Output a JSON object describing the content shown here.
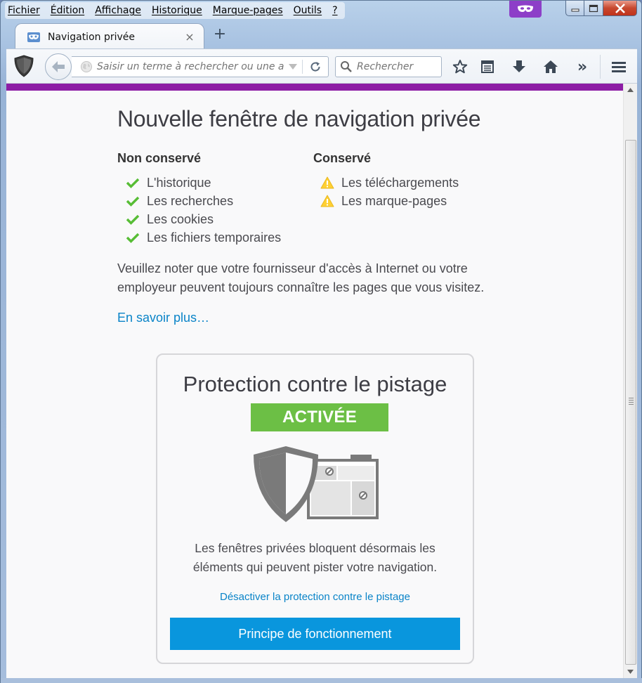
{
  "menubar": {
    "items": [
      "Fichier",
      "Édition",
      "Affichage",
      "Historique",
      "Marque-pages",
      "Outils",
      "?"
    ]
  },
  "tab": {
    "title": "Navigation privée",
    "close": "×",
    "new_tab": "+"
  },
  "navbar": {
    "url_placeholder": "Saisir un terme à rechercher ou une adresse",
    "search_placeholder": "Rechercher",
    "overflow": "»"
  },
  "page": {
    "title": "Nouvelle fenêtre de navigation privée",
    "not_saved_heading": "Non conservé",
    "not_saved_items": [
      "L'historique",
      "Les recherches",
      "Les cookies",
      "Les fichiers temporaires"
    ],
    "saved_heading": "Conservé",
    "saved_items": [
      "Les téléchargements",
      "Les marque-pages"
    ],
    "notice_line1": "Veuillez noter que votre fournisseur d'accès à Internet ou votre",
    "notice_line2": "employeur peuvent toujours connaître les pages que vous visitez.",
    "learn_more": "En savoir plus…"
  },
  "tracking": {
    "title": "Protection contre le pistage",
    "status": "ACTIVÉE",
    "desc_line1": "Les fenêtres privées bloquent désormais les",
    "desc_line2": "éléments qui peuvent pister votre navigation.",
    "disable_link": "Désactiver la protection contre le pistage",
    "how_button": "Principe de fonctionnement"
  },
  "colors": {
    "private_accent": "#8d1da5",
    "check_green": "#57bd35",
    "warning_yellow": "#ffd033",
    "badge_green": "#6cbf45",
    "link_blue": "#0a84c8",
    "button_blue": "#0996dd"
  },
  "icons": {
    "tab": "private-mask-icon",
    "shield": "shield-icon",
    "back": "back-arrow-icon",
    "globe": "globe-icon",
    "dropdown": "dropdown-arrow-icon",
    "reload": "reload-icon",
    "search": "search-icon",
    "bookmark_star": "star-icon",
    "bookmarks_menu": "bookmarks-list-icon",
    "downloads": "download-icon",
    "home": "home-icon",
    "overflow": "overflow-chevrons-icon",
    "menu": "hamburger-menu-icon",
    "check": "check-icon",
    "warning": "warning-icon"
  }
}
